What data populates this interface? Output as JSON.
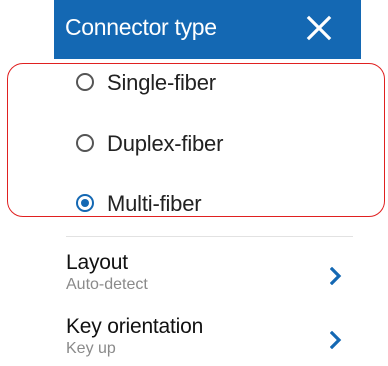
{
  "dialog": {
    "title": "Connector type",
    "accent_color": "#1468b3",
    "close_icon": "close-icon"
  },
  "options": [
    {
      "label": "Single-fiber",
      "selected": false
    },
    {
      "label": "Duplex-fiber",
      "selected": false
    },
    {
      "label": "Multi-fiber",
      "selected": true
    }
  ],
  "highlight_color": "#e02020",
  "menu": [
    {
      "title": "Layout",
      "value": "Auto-detect",
      "icon": "chevron-right-icon"
    },
    {
      "title": "Key orientation",
      "value": "Key up",
      "icon": "chevron-right-icon"
    }
  ]
}
